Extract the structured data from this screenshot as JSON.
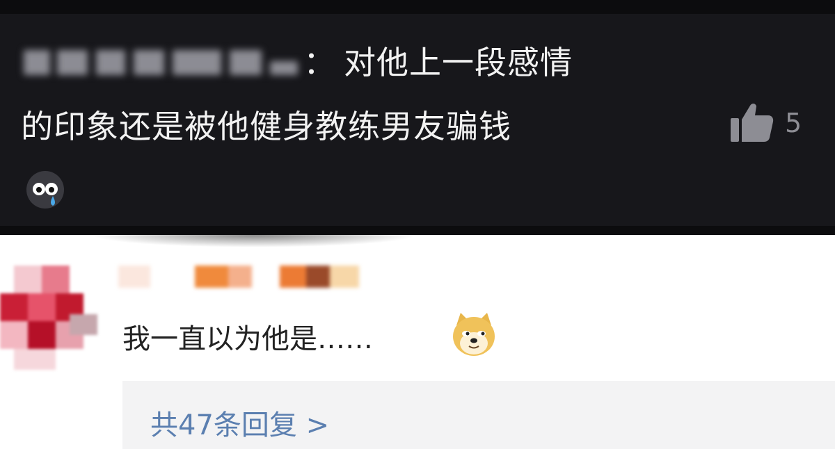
{
  "comment": {
    "author_masked": "",
    "colon": "：",
    "line1": "对他上一段感情",
    "line2": "的印象还是被他健身教练男友骗钱",
    "like_count": "5",
    "like_icon": "thumbs-up-icon",
    "emoji_icon": "crying-emoji-icon"
  },
  "reply": {
    "text": "我一直以为他是……",
    "emoji_icon": "doge-emoji-icon",
    "replies_link": "共47条回复 >"
  },
  "colors": {
    "dark_bg": "#17171b",
    "link": "#5b7fb0",
    "reply_box_bg": "#f3f3f4"
  }
}
